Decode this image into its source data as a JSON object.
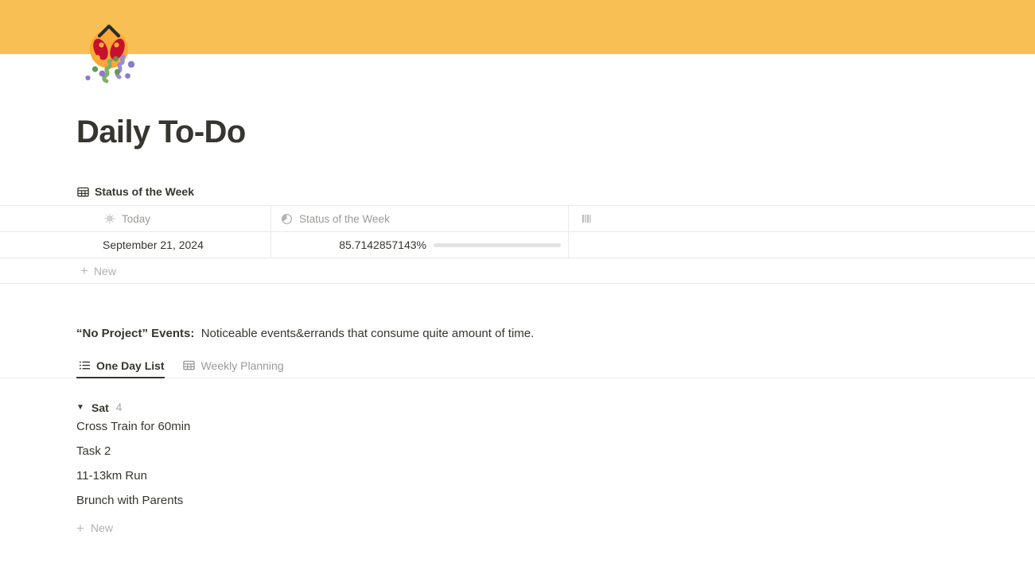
{
  "cover": {
    "color": "#f8bf55"
  },
  "page": {
    "icon": "confetti-ball-icon",
    "title": "Daily To-Do"
  },
  "status_database": {
    "title": "Status of the Week",
    "title_icon": "table-icon",
    "columns": [
      {
        "label": "Today",
        "icon": "date-icon"
      },
      {
        "label": "Status of the Week",
        "icon": "pie-progress-icon"
      },
      {
        "label": "",
        "icon": "bars-icon"
      }
    ],
    "rows": [
      {
        "today": "September 21, 2024",
        "status_percent_label": "85.7142857143%",
        "status_percent_value": 85.7142857143,
        "extra": ""
      }
    ],
    "new_row_label": "New",
    "new_row_icon": "plus-icon",
    "progress_fill_color": "#6e9075",
    "progress_track_color": "#e3e2e0"
  },
  "callout": {
    "bold_prefix": "“No Project” Events:",
    "description": "Noticeable events&errands that consume quite amount of time."
  },
  "task_database": {
    "tabs": [
      {
        "label": "One Day List",
        "icon": "list-icon",
        "active": true
      },
      {
        "label": "Weekly Planning",
        "icon": "table-icon",
        "active": false
      }
    ],
    "group": {
      "caret": "▼",
      "name": "Sat",
      "count": "4"
    },
    "tasks": [
      {
        "title": "Cross Train for 60min"
      },
      {
        "title": "Task 2"
      },
      {
        "title": "11-13km Run"
      },
      {
        "title": "Brunch with Parents"
      }
    ],
    "new_row_label": "New",
    "new_row_icon": "plus-icon"
  }
}
